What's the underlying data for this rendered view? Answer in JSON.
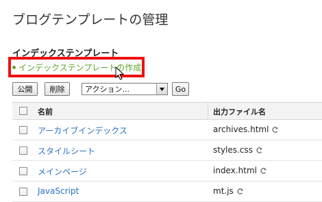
{
  "page_title": "ブログテンプレートの管理",
  "section_title": "インデックステンプレート",
  "create_link": "インデックステンプレートの作成",
  "toolbar": {
    "publish_label": "公開",
    "delete_label": "削除",
    "action_select_value": "アクション...",
    "go_label": "Go"
  },
  "table": {
    "headers": {
      "name": "名前",
      "output_file": "出力ファイル名"
    },
    "rows": [
      {
        "name": "アーカイブインデックス",
        "file": "archives.html"
      },
      {
        "name": "スタイルシート",
        "file": "styles.css"
      },
      {
        "name": "メインページ",
        "file": "index.html"
      },
      {
        "name": "JavaScript",
        "file": "mt.js"
      }
    ]
  },
  "colors": {
    "link_green": "#5aa52a",
    "link_blue": "#2a6fbf",
    "highlight_red": "#ee1111"
  },
  "icons": {
    "publish_file": "refresh-arrow-icon",
    "cursor": "mouse-pointer-icon"
  }
}
